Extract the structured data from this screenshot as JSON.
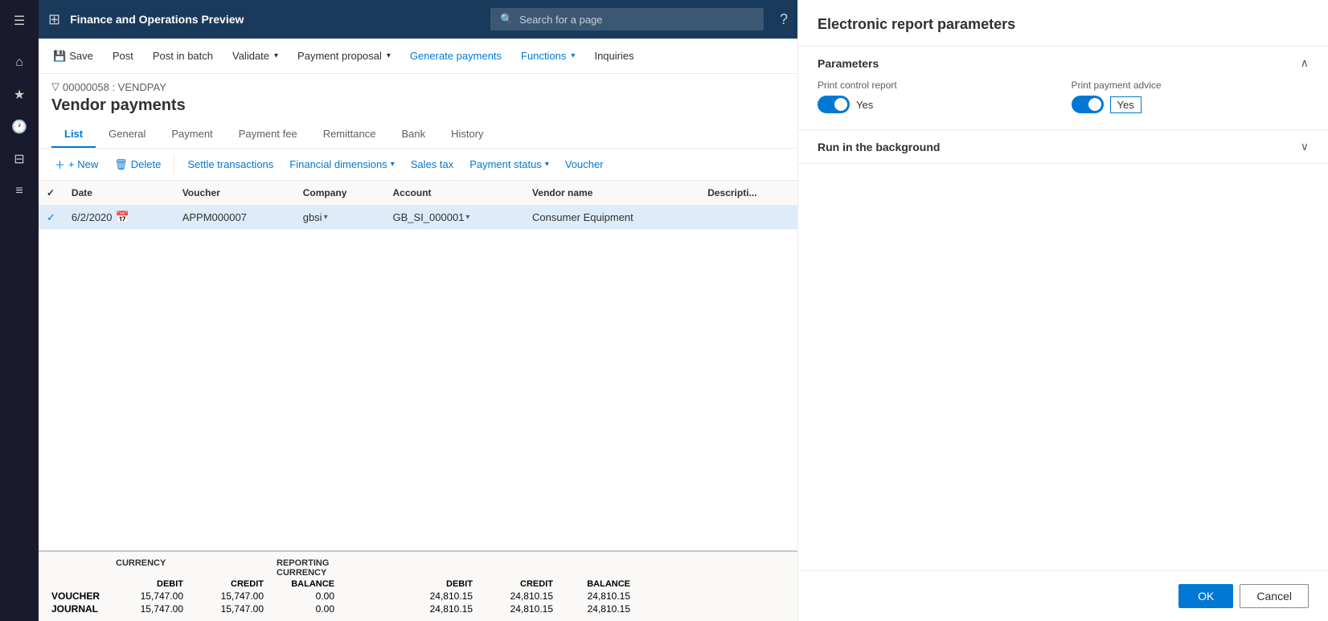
{
  "app": {
    "title": "Finance and Operations Preview",
    "search_placeholder": "Search for a page"
  },
  "sidebar": {
    "icons": [
      {
        "name": "grid-icon",
        "symbol": "⊞"
      },
      {
        "name": "home-icon",
        "symbol": "⌂"
      },
      {
        "name": "star-icon",
        "symbol": "★"
      },
      {
        "name": "clock-icon",
        "symbol": "🕐"
      },
      {
        "name": "table-icon",
        "symbol": "⊟"
      },
      {
        "name": "list-icon",
        "symbol": "≡"
      }
    ]
  },
  "command_bar": {
    "save_label": "Save",
    "post_label": "Post",
    "post_batch_label": "Post in batch",
    "validate_label": "Validate",
    "payment_proposal_label": "Payment proposal",
    "generate_payments_label": "Generate payments",
    "functions_label": "Functions",
    "inquiries_label": "Inquiries"
  },
  "page": {
    "breadcrumb": "00000058 : VENDPAY",
    "title": "Vendor payments",
    "tabs": [
      {
        "label": "List",
        "active": true
      },
      {
        "label": "General"
      },
      {
        "label": "Payment"
      },
      {
        "label": "Payment fee"
      },
      {
        "label": "Remittance"
      },
      {
        "label": "Bank"
      },
      {
        "label": "History"
      }
    ]
  },
  "sub_toolbar": {
    "new_label": "+ New",
    "delete_label": "Delete",
    "settle_label": "Settle transactions",
    "financial_dim_label": "Financial dimensions",
    "sales_tax_label": "Sales tax",
    "payment_status_label": "Payment status",
    "voucher_label": "Voucher"
  },
  "table": {
    "columns": [
      "",
      "Date",
      "Voucher",
      "Company",
      "Account",
      "Vendor name",
      "Description"
    ],
    "rows": [
      {
        "selected": true,
        "date": "6/2/2020",
        "voucher": "APPM000007",
        "company": "gbsi",
        "account": "GB_SI_000001",
        "vendor_name": "Consumer Equipment",
        "description": ""
      }
    ]
  },
  "summary": {
    "currency_label": "CURRENCY",
    "reporting_currency_label": "REPORTING CURRENCY",
    "debit_label": "DEBIT",
    "credit_label": "CREDIT",
    "balance_label": "BALANCE",
    "rows": [
      {
        "label": "VOUCHER",
        "debit": "15,747.00",
        "credit": "15,747.00",
        "balance": "0.00",
        "r_debit": "24,810.15",
        "r_credit": "24,810.15",
        "r_balance": "24,810.15"
      },
      {
        "label": "JOURNAL",
        "debit": "15,747.00",
        "credit": "15,747.00",
        "balance": "0.00",
        "r_debit": "24,810.15",
        "r_credit": "24,810.15",
        "r_balance": "24,810.15"
      }
    ]
  },
  "panel": {
    "title": "Electronic report parameters",
    "parameters_section_title": "Parameters",
    "run_background_section_title": "Run in the background",
    "print_control_report_label": "Print control report",
    "print_control_report_value": "Yes",
    "print_control_report_on": true,
    "print_payment_advice_label": "Print payment advice",
    "print_payment_advice_value": "Yes",
    "print_payment_advice_on": true,
    "ok_label": "OK",
    "cancel_label": "Cancel"
  }
}
